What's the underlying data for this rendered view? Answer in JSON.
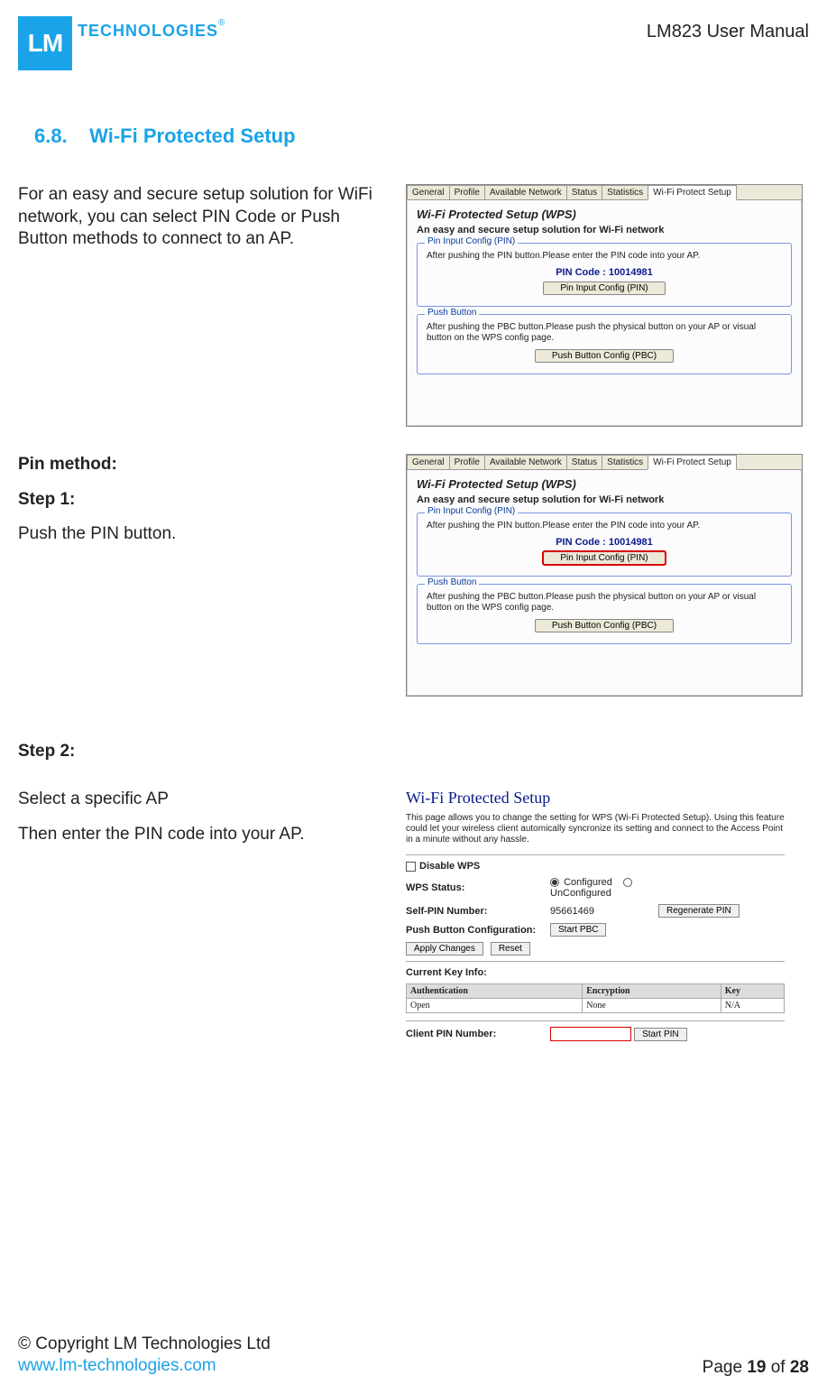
{
  "header": {
    "logo_square": "LM",
    "logo_text": "TECHNOLOGIES",
    "reg_mark": "®",
    "doc_title": "LM823 User Manual"
  },
  "section": {
    "number": "6.8.",
    "title": "Wi-Fi Protected Setup"
  },
  "intro_para": "For an easy and secure setup solution for WiFi network, you can select PIN Code or Push Button methods to connect to an AP.",
  "pin_method_heading": "Pin method:",
  "step1_heading": "Step 1:",
  "step1_text": "Push the PIN button.",
  "step2_heading": "Step 2:",
  "step2_text1": "Select a specific AP",
  "step2_text2": "Then enter the PIN code into your AP.",
  "dialog": {
    "tabs": [
      "General",
      "Profile",
      "Available Network",
      "Status",
      "Statistics",
      "Wi-Fi Protect Setup"
    ],
    "active_tab_index": 5,
    "title": "Wi-Fi Protected Setup (WPS)",
    "subtitle": "An easy and secure setup solution for Wi-Fi network",
    "pin_group": {
      "legend": "Pin Input Config (PIN)",
      "text": "After pushing the PIN button.Please enter the PIN code into your AP.",
      "pin_label": "PIN Code :  10014981",
      "button": "Pin Input Config (PIN)"
    },
    "pbc_group": {
      "legend": "Push Button",
      "text": "After pushing the PBC button.Please push the physical button on your AP or visual button on the WPS config page.",
      "button": "Push Button Config (PBC)"
    }
  },
  "router": {
    "title": "Wi-Fi Protected Setup",
    "desc": "This page allows you to change the setting for WPS (Wi-Fi Protected Setup). Using this feature could let your wireless client automically syncronize its setting and connect to the Access Point in a minute without any hassle.",
    "disable_label": "Disable WPS",
    "rows": {
      "status_label": "WPS Status:",
      "status_configured": "Configured",
      "status_unconfigured": "UnConfigured",
      "self_pin_label": "Self-PIN Number:",
      "self_pin_value": "95661469",
      "regen_btn": "Regenerate PIN",
      "pbc_label": "Push Button Configuration:",
      "start_pbc_btn": "Start PBC",
      "apply_btn": "Apply Changes",
      "reset_btn": "Reset",
      "key_info_label": "Current Key Info:"
    },
    "table": {
      "headers": [
        "Authentication",
        "Encryption",
        "Key"
      ],
      "row": [
        "Open",
        "None",
        "N/A"
      ]
    },
    "client_pin_label": "Client PIN Number:",
    "start_pin_btn": "Start PIN"
  },
  "footer": {
    "copyright": "© Copyright LM Technologies Ltd",
    "url": "www.lm-technologies.com",
    "page_prefix": "Page ",
    "page_current": "19",
    "page_sep": " of ",
    "page_total": "28"
  }
}
